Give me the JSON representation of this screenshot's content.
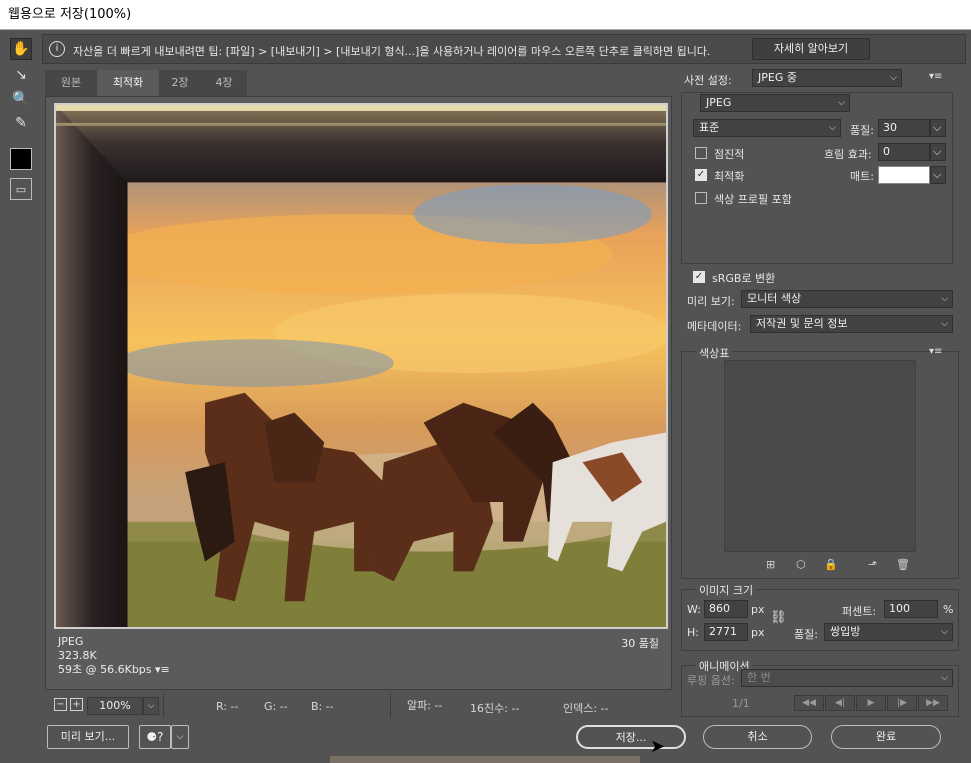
{
  "window": {
    "title": "웹용으로 저장(100%)"
  },
  "tools": [
    {
      "icon": "hand-icon",
      "glyph": "✋"
    },
    {
      "icon": "slice-select-icon",
      "glyph": "↘"
    },
    {
      "icon": "zoom-icon",
      "glyph": "🔍"
    },
    {
      "icon": "eyedropper-icon",
      "glyph": "✎"
    },
    {
      "icon": "color-swatch",
      "color": "#000000"
    },
    {
      "icon": "toggle-slices-icon",
      "glyph": "▭"
    }
  ],
  "tip": {
    "text": "자산을 더 빠르게 내보내려면 팁: [파일] > [내보내기] > [내보내기 형식...]을 사용하거나 레이어를 마우스 오른쪽 단추로 클릭하면 됩니다.",
    "learn_more": "자세히 알아보기"
  },
  "tabs": [
    "원본",
    "최적화",
    "2장",
    "4장"
  ],
  "active_tab": "최적화",
  "image_info": {
    "format": "JPEG",
    "size": "323.8K",
    "time": "59초 @ 56.6Kbps",
    "quality": "30 품질",
    "menu_glyph": "▾≡"
  },
  "zoom": {
    "minus": "−",
    "plus": "+",
    "value": "100%",
    "dropdown": "⌵"
  },
  "readouts": {
    "r": "R: --",
    "g": "G: --",
    "b": "B: --",
    "alpha": "알파: --",
    "hex": "16진수: --",
    "index": "인덱스: --"
  },
  "buttons": {
    "preview": "미리 보기...",
    "help_glyph": "⚈?",
    "help_dropdown": "⌵",
    "save": "저장...",
    "cancel": "취소",
    "done": "완료"
  },
  "preset": {
    "label": "사전 설정:",
    "value": "JPEG 중",
    "menu_glyph": "▾≡"
  },
  "settings": {
    "format": "JPEG",
    "compression": "표준",
    "quality_label": "품질:",
    "quality_value": "30",
    "progressive": "점진적",
    "progressive_checked": false,
    "blur_label": "흐림 효과:",
    "blur_value": "0",
    "optimized": "최적화",
    "optimized_checked": true,
    "matte_label": "매트:",
    "matte_color": "#ffffff",
    "embed_profile": "색상 프로필 포함",
    "embed_profile_checked": false,
    "check_glyph": "✓"
  },
  "convert": {
    "label": "sRGB로 변환",
    "checked": true
  },
  "preview": {
    "label": "미리 보기:",
    "value": "모니터 색상"
  },
  "metadata": {
    "label": "메타데이터:",
    "value": "저작권 및 문의 정보"
  },
  "color_table": {
    "title": "색상표",
    "menu_glyph": "▾≡",
    "icons": [
      "⊞",
      "⬡",
      "🔒",
      "⬏",
      "🗑"
    ]
  },
  "image_size": {
    "title": "이미지 크기",
    "w_label": "W:",
    "w_value": "860",
    "h_label": "H:",
    "h_value": "2771",
    "unit": "px",
    "percent_label": "퍼센트:",
    "percent_value": "100",
    "percent_unit": "%",
    "quality_label": "품질:",
    "quality_value": "쌍입방",
    "link_glyph": "⛓"
  },
  "animation": {
    "title": "애니메이션",
    "loop_label": "루핑 옵션:",
    "loop_value": "한 번",
    "frame": "1/1",
    "controls": [
      "◀◀",
      "◀|",
      "▶",
      "|▶",
      "▶▶"
    ]
  },
  "dropdown_arrow": "⌵",
  "colors": {
    "window": "#535353",
    "panel_dark": "#424242",
    "accent_border": "#bdbdbd"
  }
}
